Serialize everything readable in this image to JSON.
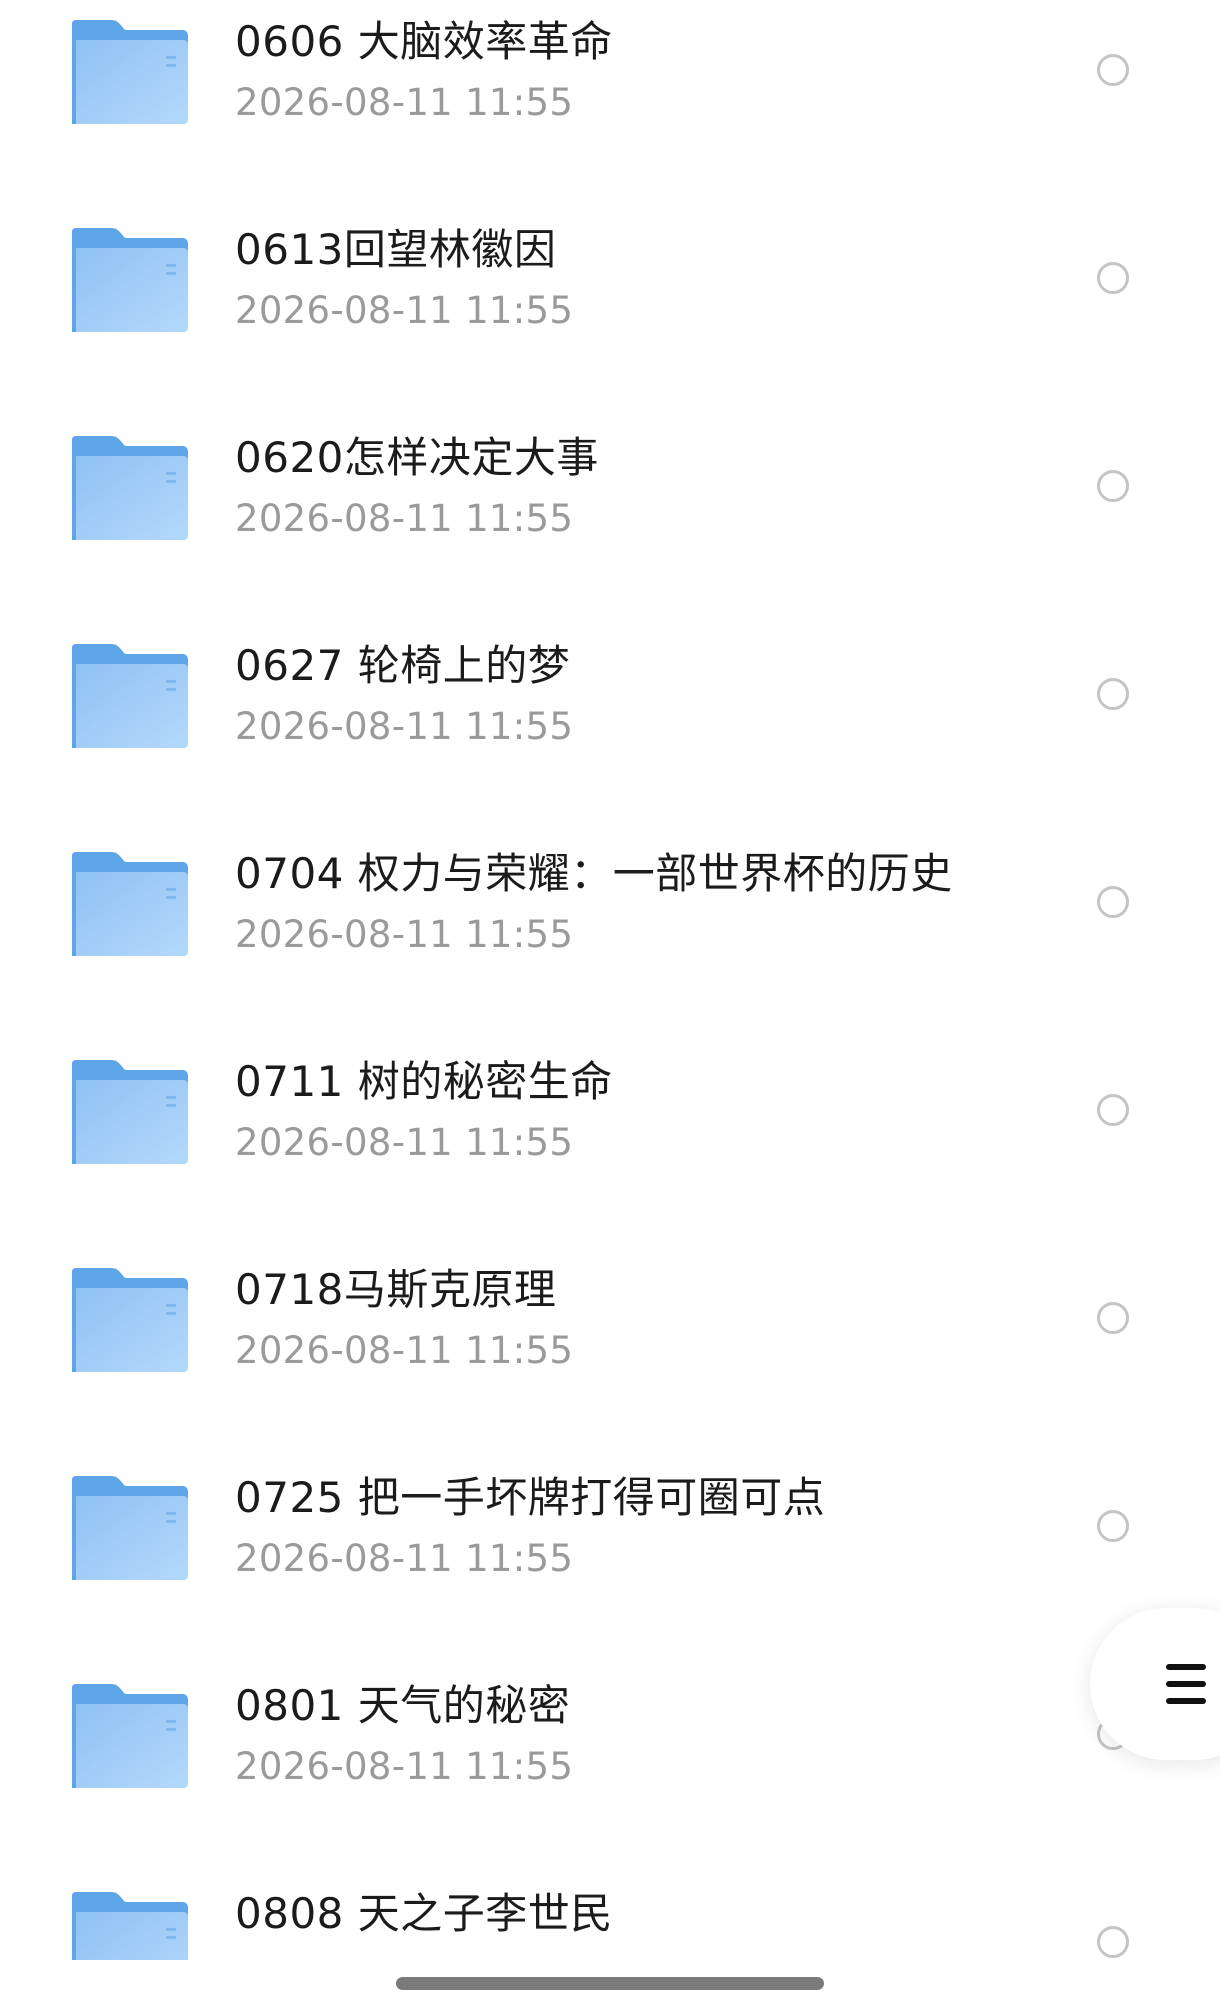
{
  "files": [
    {
      "name": "0606 大脑效率革命",
      "modified": "2026-08-11 11:55"
    },
    {
      "name": "0613回望林徽因",
      "modified": "2026-08-11 11:55"
    },
    {
      "name": "0620怎样决定大事",
      "modified": "2026-08-11 11:55"
    },
    {
      "name": "0627 轮椅上的梦",
      "modified": "2026-08-11 11:55"
    },
    {
      "name": "0704 权力与荣耀：一部世界杯的历史",
      "modified": "2026-08-11 11:55"
    },
    {
      "name": "0711 树的秘密生命",
      "modified": "2026-08-11 11:55"
    },
    {
      "name": "0718马斯克原理",
      "modified": "2026-08-11 11:55"
    },
    {
      "name": "0725 把一手坏牌打得可圈可点",
      "modified": "2026-08-11 11:55"
    },
    {
      "name": "0801 天气的秘密",
      "modified": "2026-08-11 11:55"
    },
    {
      "name": "0808 天之子李世民",
      "modified": ""
    }
  ],
  "icons": {
    "folder": "folder-icon",
    "select": "select-circle-icon",
    "menu": "menu-icon"
  },
  "colors": {
    "folder_front": "#a8d0f7",
    "folder_back": "#5ea5ea",
    "title_text": "#1b1b1b",
    "subtitle_text": "#9a9a9a",
    "checkbox_border": "#c4c4c4"
  }
}
